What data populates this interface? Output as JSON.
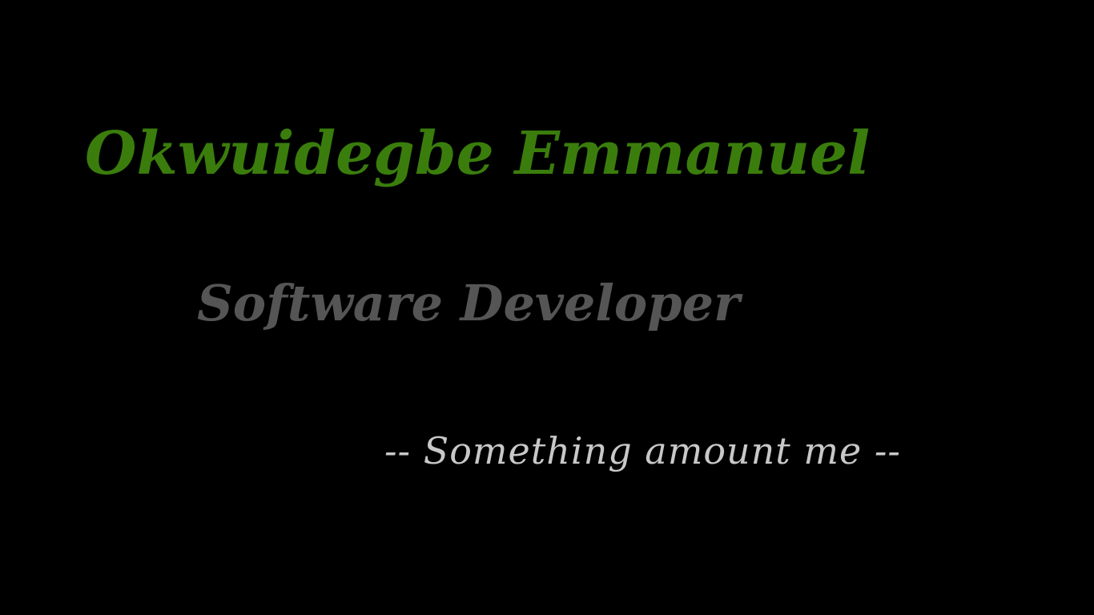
{
  "hero": {
    "name": "Okwuidegbe Emmanuel",
    "role": "Software Developer",
    "tagline": "-- Something amount me --"
  },
  "colors": {
    "background": "#000000",
    "name": "#3a7d0c",
    "role": "#555555",
    "tagline": "#c8c8c8"
  }
}
